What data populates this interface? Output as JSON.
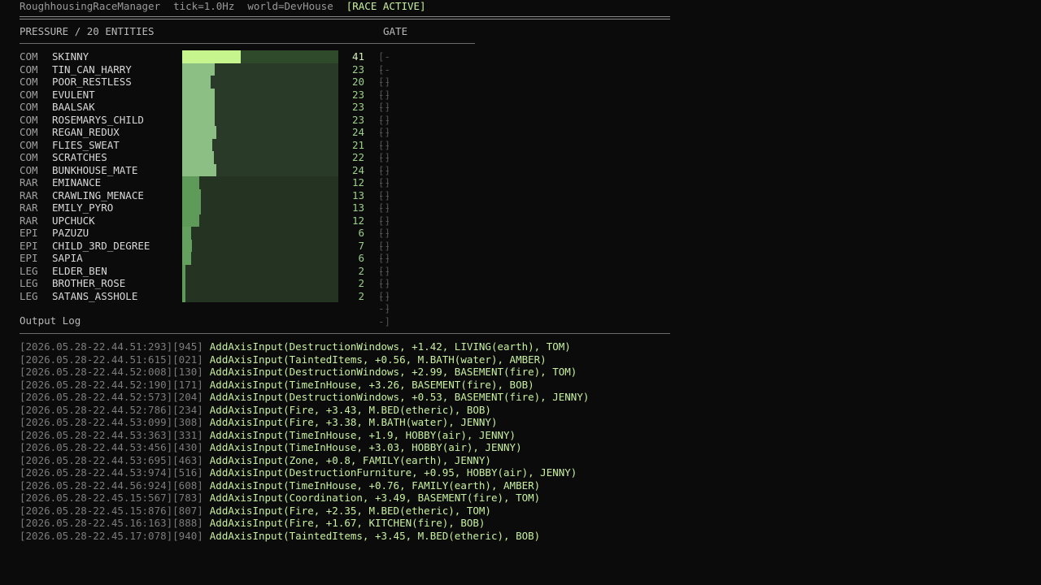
{
  "topbar": {
    "app": "RoughhousingRaceManager",
    "tick": "tick=1.0Hz",
    "world": "world=DevHouse",
    "status": "[RACE ACTIVE]"
  },
  "pressure": {
    "header": "PRESSURE / 20 ENTITIES",
    "gate_header": "GATE",
    "max_value": 41,
    "entities": [
      {
        "tier": "COM",
        "name": "SKINNY",
        "value": 41,
        "gate": "[----]"
      },
      {
        "tier": "COM",
        "name": "TIN_CAN_HARRY",
        "value": 23,
        "gate": "[----]"
      },
      {
        "tier": "COM",
        "name": "POOR_RESTLESS",
        "value": 20,
        "gate": "[----]"
      },
      {
        "tier": "COM",
        "name": "EVULENT",
        "value": 23,
        "gate": "[----]"
      },
      {
        "tier": "COM",
        "name": "BAALSAK",
        "value": 23,
        "gate": "[----]"
      },
      {
        "tier": "COM",
        "name": "ROSEMARYS_CHILD",
        "value": 23,
        "gate": "[----]"
      },
      {
        "tier": "COM",
        "name": "REGAN_REDUX",
        "value": 24,
        "gate": "[----]"
      },
      {
        "tier": "COM",
        "name": "FLIES_SWEAT",
        "value": 21,
        "gate": "[----]"
      },
      {
        "tier": "COM",
        "name": "SCRATCHES",
        "value": 22,
        "gate": "[----]"
      },
      {
        "tier": "COM",
        "name": "BUNKHOUSE_MATE",
        "value": 24,
        "gate": "[----]"
      },
      {
        "tier": "RAR",
        "name": "EMINANCE",
        "value": 12,
        "gate": "[----]"
      },
      {
        "tier": "RAR",
        "name": "CRAWLING_MENACE",
        "value": 13,
        "gate": "[----]"
      },
      {
        "tier": "RAR",
        "name": "EMILY_PYRO",
        "value": 13,
        "gate": "[----]"
      },
      {
        "tier": "RAR",
        "name": "UPCHUCK",
        "value": 12,
        "gate": "[----]"
      },
      {
        "tier": "EPI",
        "name": "PAZUZU",
        "value": 6,
        "gate": "[----]"
      },
      {
        "tier": "EPI",
        "name": "CHILD_3RD_DEGREE",
        "value": 7,
        "gate": "[----]"
      },
      {
        "tier": "EPI",
        "name": "SAPIA",
        "value": 6,
        "gate": "[----]"
      },
      {
        "tier": "LEG",
        "name": "ELDER_BEN",
        "value": 2,
        "gate": "[----]"
      },
      {
        "tier": "LEG",
        "name": "BROTHER_ROSE",
        "value": 2,
        "gate": "[----]"
      },
      {
        "tier": "LEG",
        "name": "SATANS_ASSHOLE",
        "value": 2,
        "gate": "[----]"
      }
    ]
  },
  "colors": {
    "top_fill": "#c5f58c",
    "top_track": "#2e4a2a",
    "com_fill": "#8cbf84",
    "com_track": "#293a28",
    "rar_fill": "#5e9a58",
    "epi_fill": "#64a05e",
    "low_track": "#243322"
  },
  "log": {
    "title": "Output Log",
    "lines": [
      {
        "ts": "[2026.05.28-22.44.51:293][945]",
        "msg": "AddAxisInput(DestructionWindows, +1.42, LIVING(earth), TOM)"
      },
      {
        "ts": "[2026.05.28-22.44.51:615][021]",
        "msg": "AddAxisInput(TaintedItems, +0.56, M.BATH(water), AMBER)"
      },
      {
        "ts": "[2026.05.28-22.44.52:008][130]",
        "msg": "AddAxisInput(DestructionWindows, +2.99, BASEMENT(fire), TOM)"
      },
      {
        "ts": "[2026.05.28-22.44.52:190][171]",
        "msg": "AddAxisInput(TimeInHouse, +3.26, BASEMENT(fire), BOB)"
      },
      {
        "ts": "[2026.05.28-22.44.52:573][204]",
        "msg": "AddAxisInput(DestructionWindows, +0.53, BASEMENT(fire), JENNY)"
      },
      {
        "ts": "[2026.05.28-22.44.52:786][234]",
        "msg": "AddAxisInput(Fire, +3.43, M.BED(etheric), BOB)"
      },
      {
        "ts": "[2026.05.28-22.44.53:099][308]",
        "msg": "AddAxisInput(Fire, +3.38, M.BATH(water), JENNY)"
      },
      {
        "ts": "[2026.05.28-22.44.53:363][331]",
        "msg": "AddAxisInput(TimeInHouse, +1.9, HOBBY(air), JENNY)"
      },
      {
        "ts": "[2026.05.28-22.44.53:456][430]",
        "msg": "AddAxisInput(TimeInHouse, +3.03, HOBBY(air), JENNY)"
      },
      {
        "ts": "[2026.05.28-22.44.53:695][463]",
        "msg": "AddAxisInput(Zone, +0.8, FAMILY(earth), JENNY)"
      },
      {
        "ts": "[2026.05.28-22.44.53:974][516]",
        "msg": "AddAxisInput(DestructionFurniture, +0.95, HOBBY(air), JENNY)"
      },
      {
        "ts": "[2026.05.28-22.44.56:924][608]",
        "msg": "AddAxisInput(TimeInHouse, +0.76, FAMILY(earth), AMBER)"
      },
      {
        "ts": "[2026.05.28-22.45.15:567][783]",
        "msg": "AddAxisInput(Coordination, +3.49, BASEMENT(fire), TOM)"
      },
      {
        "ts": "[2026.05.28-22.45.15:876][807]",
        "msg": "AddAxisInput(Fire, +2.35, M.BED(etheric), TOM)"
      },
      {
        "ts": "[2026.05.28-22.45.16:163][888]",
        "msg": "AddAxisInput(Fire, +1.67, KITCHEN(fire), BOB)"
      },
      {
        "ts": "[2026.05.28-22.45.17:078][940]",
        "msg": "AddAxisInput(TaintedItems, +3.45, M.BED(etheric), BOB)"
      }
    ]
  }
}
